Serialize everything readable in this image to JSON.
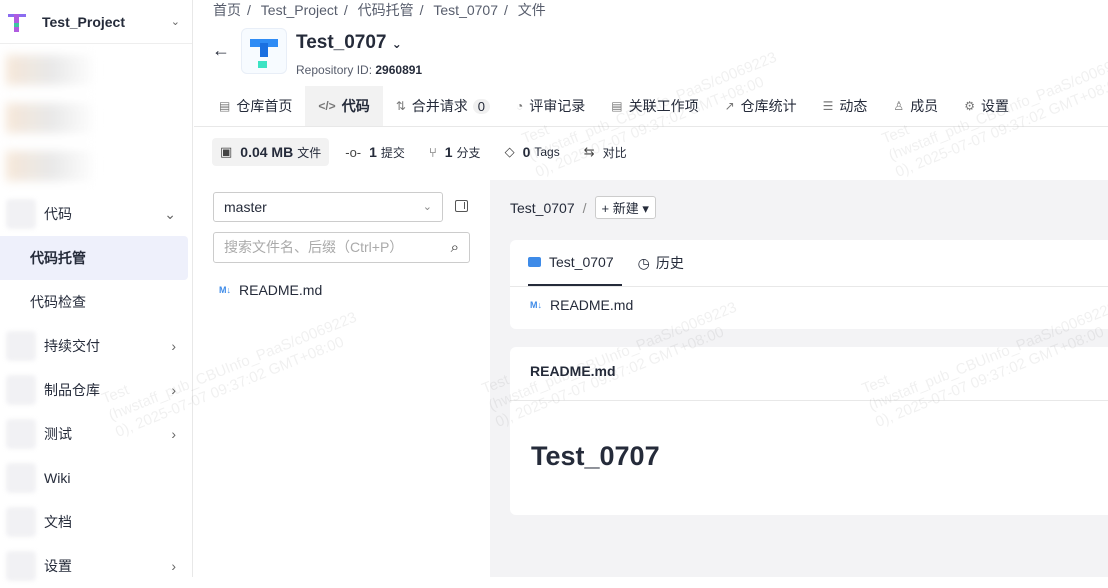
{
  "sidebar": {
    "project": "Test_Project",
    "items": [
      {
        "label": "代码",
        "arrow": "⌄"
      },
      {
        "label": "代码托管"
      },
      {
        "label": "代码检查"
      },
      {
        "label": "持续交付",
        "arrow": "›"
      },
      {
        "label": "制品仓库",
        "arrow": "›"
      },
      {
        "label": "测试",
        "arrow": "›"
      },
      {
        "label": "Wiki"
      },
      {
        "label": "文档"
      },
      {
        "label": "设置",
        "arrow": "›"
      }
    ]
  },
  "breadcrumb": [
    "首页",
    "/",
    "Test_Project",
    "/",
    "代码托管",
    "/",
    "Test_0707",
    "/",
    "文件"
  ],
  "repo": {
    "name": "Test_0707",
    "id_label": "Repository ID:",
    "id": "2960891"
  },
  "tabs": [
    {
      "label": "仓库首页"
    },
    {
      "label": "代码"
    },
    {
      "label": "合并请求",
      "badge": "0"
    },
    {
      "label": "评审记录"
    },
    {
      "label": "关联工作项"
    },
    {
      "label": "仓库统计"
    },
    {
      "label": "动态"
    },
    {
      "label": "成员"
    },
    {
      "label": "设置"
    }
  ],
  "stats": {
    "size": "0.04 MB",
    "size_unit": "文件",
    "commits": "1",
    "commits_unit": "提交",
    "branches": "1",
    "branches_unit": "分支",
    "tags": "0",
    "tags_unit": "Tags",
    "compare": "对比"
  },
  "branch": "master",
  "search_placeholder": "搜索文件名、后缀（Ctrl+P）",
  "files": [
    "README.md"
  ],
  "path": {
    "root": "Test_0707",
    "sep": "/",
    "new": "+ 新建 ▾"
  },
  "content_tabs": [
    "Test_0707",
    "历史"
  ],
  "readme": {
    "title": "README.md",
    "heading": "Test_0707"
  },
  "watermark": "Test\n(hwstaff_pub_CBUInfo_PaaS/c0069223\n0), 2025-07-07 09:37:02 GMT+08:00"
}
